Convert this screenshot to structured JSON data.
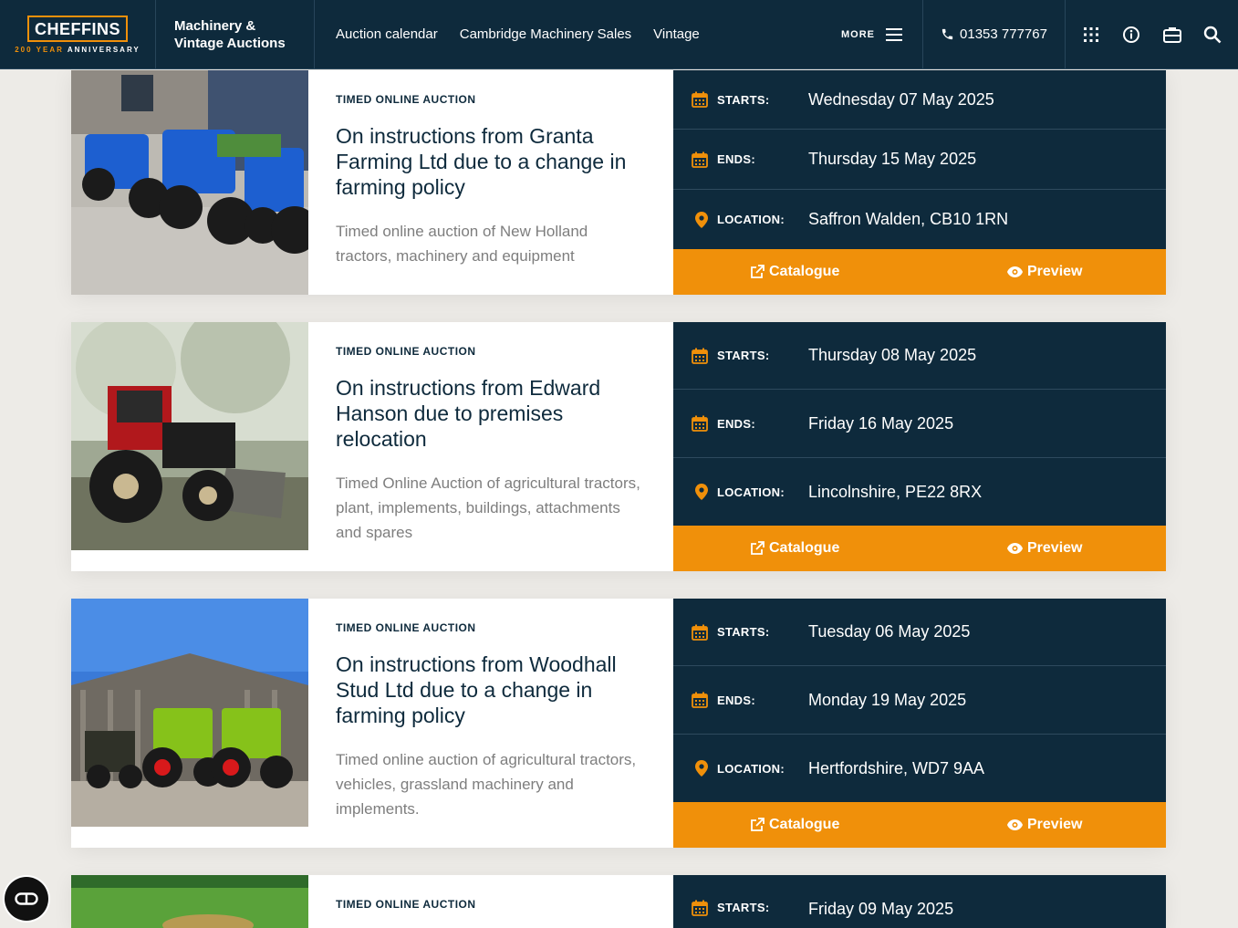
{
  "header": {
    "logo_text": "CHEFFINS",
    "logo_year": "200 YEAR",
    "logo_anniversary": "ANNIVERSARY",
    "section_line1": "Machinery &",
    "section_line2": "Vintage Auctions",
    "nav": [
      "Auction calendar",
      "Cambridge Machinery Sales",
      "Vintage"
    ],
    "more_label": "MORE",
    "phone": "01353 777767",
    "icons": [
      "grid-icon",
      "info-icon",
      "briefcase-icon",
      "search-icon"
    ]
  },
  "labels": {
    "starts": "STARTS:",
    "ends": "ENDS:",
    "location": "LOCATION:",
    "catalogue": "Catalogue",
    "preview": "Preview"
  },
  "listings": [
    {
      "kicker": "TIMED ONLINE AUCTION",
      "title": "On instructions from Granta Farming Ltd due to a change in farming policy",
      "description": "Timed online auction of New Holland tractors, machinery and equipment",
      "starts": "Wednesday 07 May 2025",
      "ends": "Thursday 15 May 2025",
      "location": "Saffron Walden, CB10 1RN"
    },
    {
      "kicker": "TIMED ONLINE AUCTION",
      "title": "On instructions from Edward Hanson due to premises relocation",
      "description": "Timed Online Auction of agricultural tractors, plant, implements, buildings, attachments and spares",
      "starts": "Thursday 08 May 2025",
      "ends": "Friday 16 May 2025",
      "location": "Lincolnshire, PE22 8RX"
    },
    {
      "kicker": "TIMED ONLINE AUCTION",
      "title": "On instructions from Woodhall Stud Ltd due to a change in farming policy",
      "description": "Timed online auction of agricultural tractors, vehicles, grassland machinery and implements.",
      "starts": "Tuesday 06 May 2025",
      "ends": "Monday 19 May 2025",
      "location": "Hertfordshire, WD7 9AA"
    },
    {
      "kicker": "TIMED ONLINE AUCTION",
      "starts": "Friday 09 May 2025"
    }
  ],
  "colors": {
    "navy": "#0e2a3c",
    "orange": "#f0900a",
    "background": "#edebe7"
  }
}
